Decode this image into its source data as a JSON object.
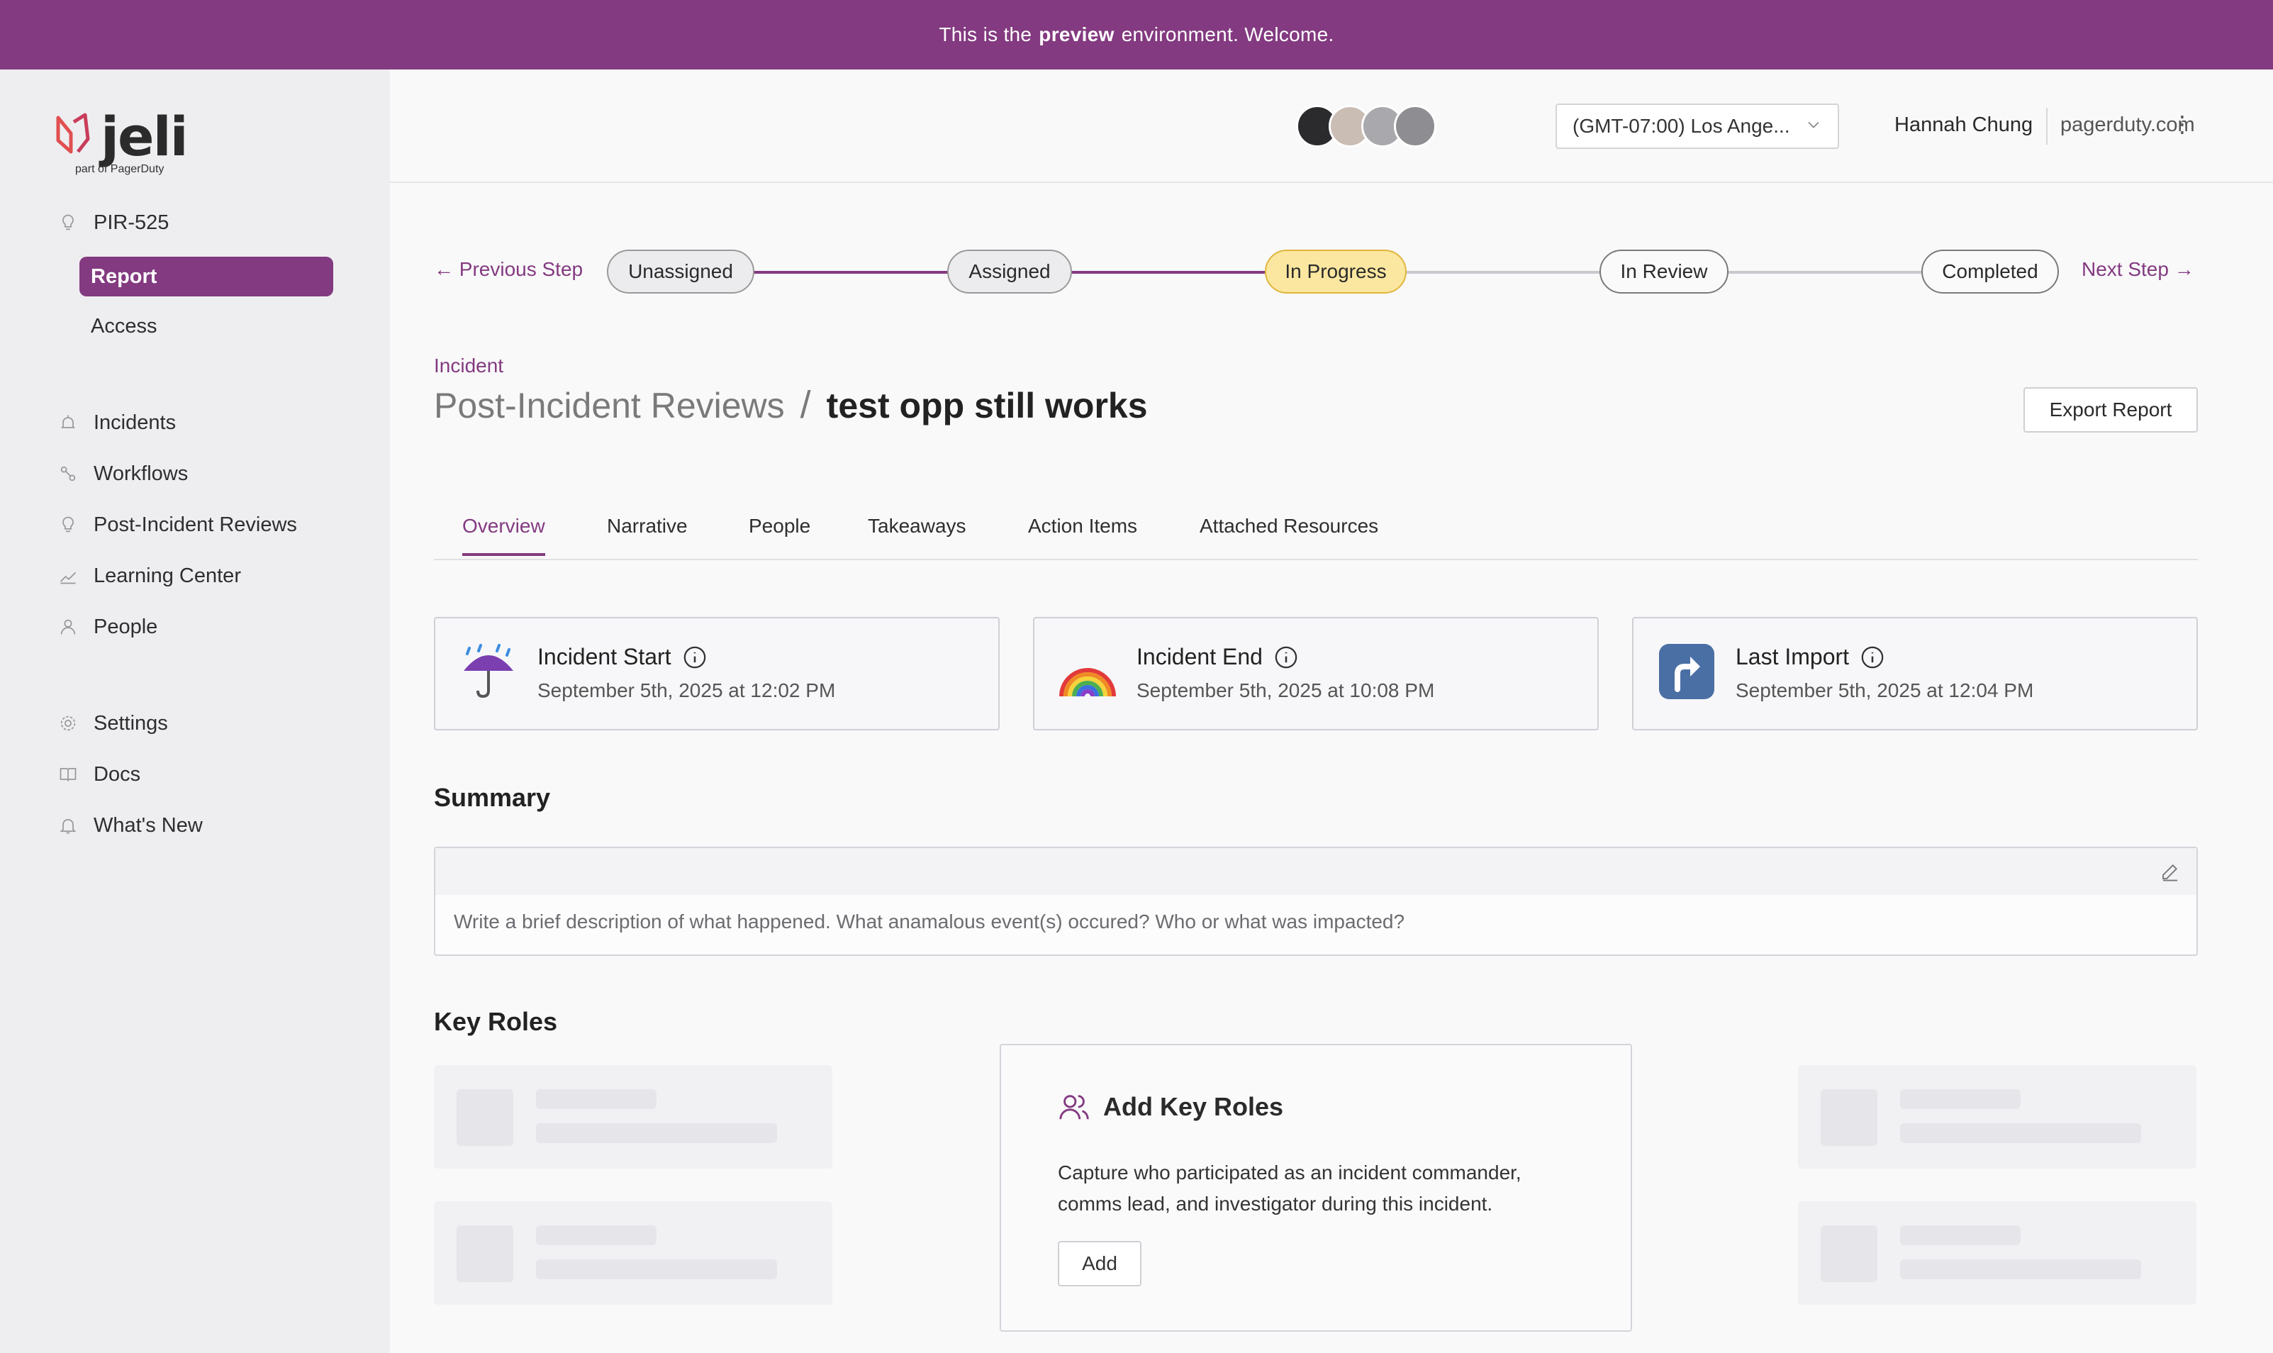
{
  "banner": {
    "prefix": "This is the",
    "bold": "preview",
    "suffix": "environment. Welcome."
  },
  "logo": {
    "word": "jeli",
    "sub": "part of PagerDuty"
  },
  "sidebar": {
    "current": "PIR-525",
    "sub_items": [
      "Report",
      "Access"
    ],
    "items": [
      {
        "label": "Incidents",
        "icon": "alarm-icon"
      },
      {
        "label": "Workflows",
        "icon": "workflow-icon"
      },
      {
        "label": "Post-Incident Reviews",
        "icon": "lightbulb-icon"
      },
      {
        "label": "Learning Center",
        "icon": "chart-line-icon"
      },
      {
        "label": "People",
        "icon": "person-icon"
      }
    ],
    "bottom": [
      {
        "label": "Settings",
        "icon": "gear-icon"
      },
      {
        "label": "Docs",
        "icon": "book-icon"
      },
      {
        "label": "What's New",
        "icon": "bell-icon"
      }
    ]
  },
  "topbar": {
    "timezone": "(GMT-07:00) Los Ange...",
    "user": "Hannah Chung",
    "org": "pagerduty.com",
    "more": "⋮"
  },
  "stepper": {
    "prev": "← Previous Step",
    "next": "Next Step →",
    "steps": [
      "Unassigned",
      "Assigned",
      "In Progress",
      "In Review",
      "Completed"
    ],
    "current_index": 2
  },
  "heading": {
    "kicker": "Incident",
    "parent": "Post-Incident Reviews",
    "sep": "/",
    "title": "test opp still works",
    "export": "Export Report"
  },
  "tabs": [
    "Overview",
    "Narrative",
    "People",
    "Takeaways",
    "Action Items",
    "Attached Resources"
  ],
  "cards": [
    {
      "title": "Incident Start",
      "date": "September 5th, 2025 at 12:02 PM",
      "icon": "umbrella-rain-icon"
    },
    {
      "title": "Incident End",
      "date": "September 5th, 2025 at 10:08 PM",
      "icon": "rainbow-icon"
    },
    {
      "title": "Last Import",
      "date": "September 5th, 2025 at 12:04 PM",
      "icon": "arrow-up-right-icon"
    }
  ],
  "summary": {
    "heading": "Summary",
    "placeholder": "Write a brief description of what happened. What anamalous event(s) occured? Who or what was impacted?"
  },
  "key_roles": {
    "heading": "Key Roles",
    "title": "Add Key Roles",
    "desc": "Capture who participated as an incident commander, comms lead, and investigator during this incident.",
    "add": "Add"
  },
  "colors": {
    "brand": "#833a80",
    "current_step": "#fbe7a0"
  }
}
